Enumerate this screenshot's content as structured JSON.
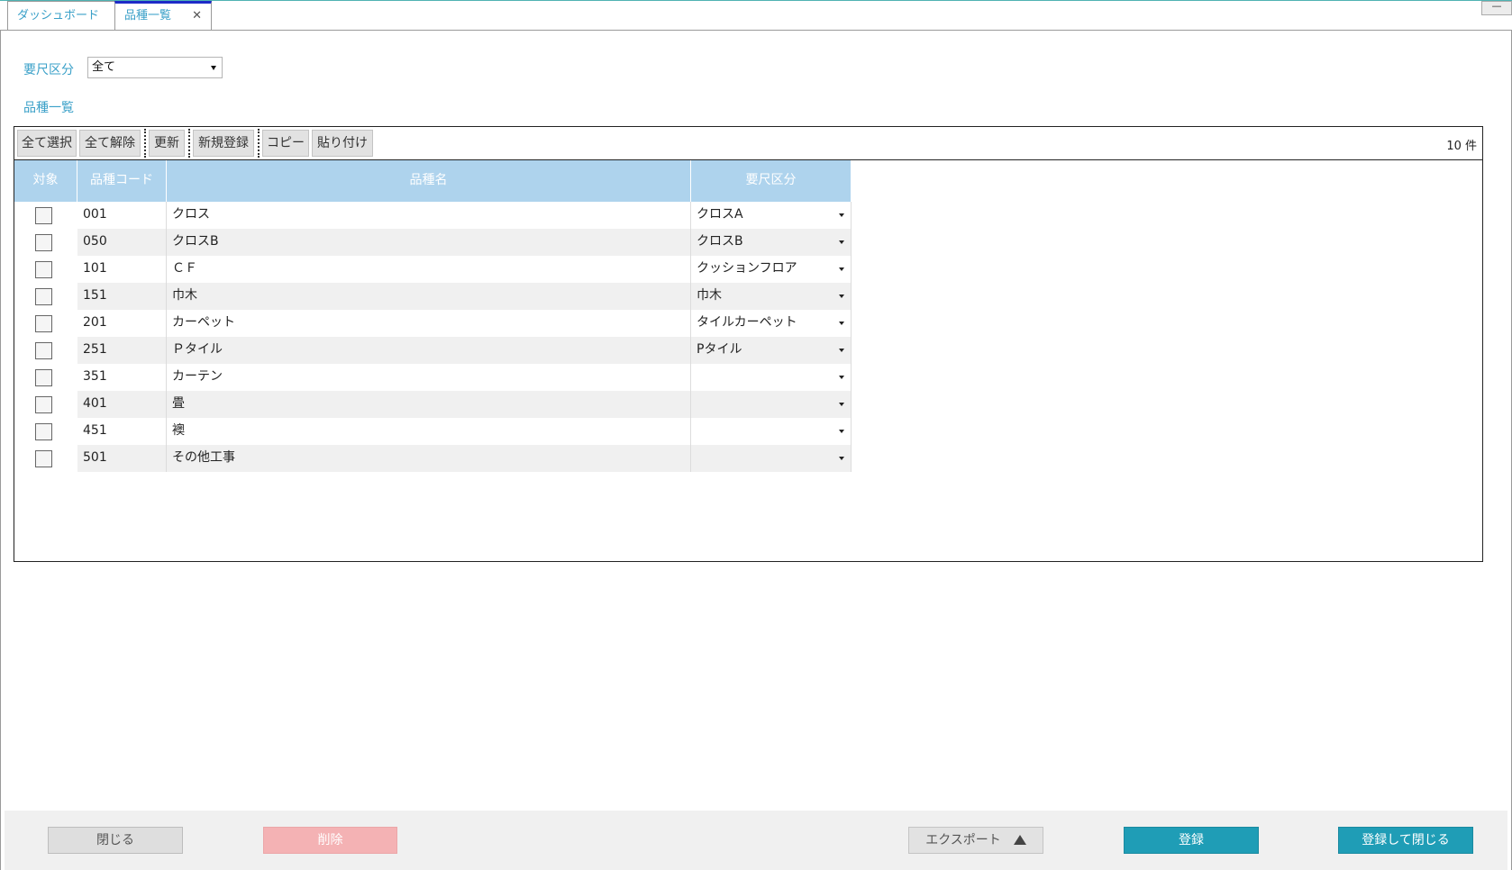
{
  "tabs": [
    {
      "label": "ダッシュボード"
    },
    {
      "label": "品種一覧",
      "close": "✕"
    }
  ],
  "window": {
    "minimize": "—"
  },
  "filter": {
    "label": "要尺区分",
    "value": "全て"
  },
  "section": {
    "title": "品種一覧"
  },
  "toolbar": {
    "select_all": "全て選択",
    "deselect_all": "全て解除",
    "refresh": "更新",
    "new": "新規登録",
    "copy": "コピー",
    "paste": "貼り付け",
    "count": "10 件"
  },
  "columns": {
    "target": "対象",
    "code": "品種コード",
    "name": "品種名",
    "category": "要尺区分"
  },
  "rows": [
    {
      "code": "001",
      "name": "クロス",
      "category": "クロスA"
    },
    {
      "code": "050",
      "name": "クロスB",
      "category": "クロスB"
    },
    {
      "code": "101",
      "name": "ＣＦ",
      "category": "クッションフロア"
    },
    {
      "code": "151",
      "name": "巾木",
      "category": "巾木"
    },
    {
      "code": "201",
      "name": "カーペット",
      "category": "タイルカーペット"
    },
    {
      "code": "251",
      "name": "Ｐタイル",
      "category": "Pタイル"
    },
    {
      "code": "351",
      "name": "カーテン",
      "category": ""
    },
    {
      "code": "401",
      "name": "畳",
      "category": ""
    },
    {
      "code": "451",
      "name": "襖",
      "category": ""
    },
    {
      "code": "501",
      "name": "その他工事",
      "category": ""
    }
  ],
  "footer": {
    "close": "閉じる",
    "delete": "削除",
    "export": "エクスポート",
    "register": "登録",
    "register_close": "登録して閉じる"
  },
  "colors": {
    "accent": "#1f9db6",
    "header": "#aed3ed",
    "label": "#3aa0c8",
    "delete": "#f4b2b4"
  }
}
